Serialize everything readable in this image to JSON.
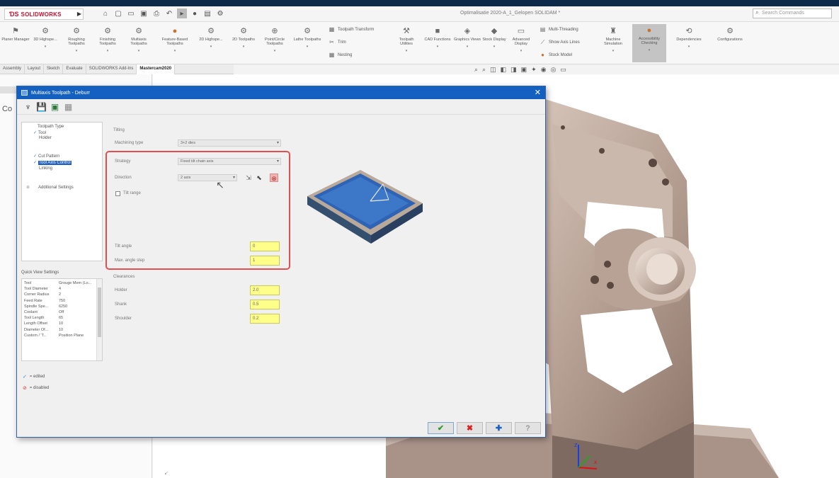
{
  "app": {
    "logo_text": "SOLIDWORKS",
    "document_title": "Optimalisatie 2020-A_1_Gelopen SOLIDAM *",
    "search_placeholder": "Search Commands"
  },
  "quick_access": [
    "home-icon",
    "new-file-icon",
    "open-icon",
    "save-icon",
    "print-icon",
    "undo-icon",
    "select-icon",
    "rebuild-icon",
    "file-properties-icon",
    "options-icon"
  ],
  "ribbon": {
    "buttons": [
      {
        "label": "Planer Manager",
        "icon": "manager-icon"
      },
      {
        "label": "3D Highspe...",
        "icon": "highspeed-icon"
      },
      {
        "label": "Roughing Toolpaths",
        "icon": "roughing-icon"
      },
      {
        "label": "Finishing Toolpaths",
        "icon": "finishing-icon"
      },
      {
        "label": "Multiaxis Toolpaths",
        "icon": "multiaxis-icon"
      },
      {
        "label": "Feature-Based Toolpaths",
        "icon": "feature-icon"
      },
      {
        "label": "2D Highspe...",
        "icon": "2d-highspeed-icon"
      },
      {
        "label": "2D Toolpaths",
        "icon": "2d-toolpath-icon"
      },
      {
        "label": "Point/Circle Toolpaths",
        "icon": "point-circle-icon"
      },
      {
        "label": "Lathe Toolpaths",
        "icon": "lathe-icon"
      },
      {
        "label": "Toolpath Utilities",
        "icon": "utilities-icon"
      },
      {
        "label": "CAD Functions",
        "icon": "cad-icon"
      },
      {
        "label": "Graphics Views",
        "icon": "graphics-icon"
      },
      {
        "label": "Stock Display",
        "icon": "stock-display-icon"
      },
      {
        "label": "Advanced Display",
        "icon": "advanced-display-icon"
      },
      {
        "label": "Machine Simulation",
        "icon": "simulation-icon"
      },
      {
        "label": "Accessibility Checking",
        "icon": "accessibility-icon"
      },
      {
        "label": "Dependencies",
        "icon": "dependencies-icon"
      },
      {
        "label": "Configurations",
        "icon": "configurations-icon"
      }
    ],
    "small_left": [
      {
        "label": "Toolpath Transform",
        "icon": "transform-icon"
      },
      {
        "label": "Trim",
        "icon": "trim-icon"
      },
      {
        "label": "Nesting",
        "icon": "nesting-icon"
      }
    ],
    "small_right": [
      {
        "label": "Multi-Threading",
        "icon": "threading-icon"
      },
      {
        "label": "Show Axis Lines",
        "icon": "axis-icon"
      },
      {
        "label": "Stock Model",
        "icon": "stock-model-icon"
      }
    ]
  },
  "tabs": [
    "Assembly",
    "Layout",
    "Sketch",
    "Evaluate",
    "SOLIDWORKS Add-Ins",
    "Mastercam2020"
  ],
  "left_panel_text": "Co",
  "dialog": {
    "title": "Multiaxis Toolpath - Deburr",
    "tree": [
      {
        "label": "Toolpath Type",
        "checked": false
      },
      {
        "label": "Tool",
        "checked": true
      },
      {
        "label": "Holder",
        "checked": false
      },
      {
        "label": "Cut Pattern",
        "checked": true
      },
      {
        "label": "Tool Axis Control",
        "checked": true,
        "selected": true
      },
      {
        "label": "Linking",
        "checked": false
      },
      {
        "label": "Additional Settings",
        "checked": false
      }
    ],
    "quick_view_label": "Quick View Settings",
    "quick_view": [
      {
        "key": "Tool",
        "value": "Grouge Mem (Lo..."
      },
      {
        "key": "Tool Diameter",
        "value": "4"
      },
      {
        "key": "Corner Radius",
        "value": "2"
      },
      {
        "key": "Feed Rate",
        "value": "750"
      },
      {
        "key": "Spindle Spe...",
        "value": "6250"
      },
      {
        "key": "Coolant",
        "value": "Off"
      },
      {
        "key": "Tool Length",
        "value": "65"
      },
      {
        "key": "Length Offset",
        "value": "10"
      },
      {
        "key": "Diameter Of...",
        "value": "10"
      },
      {
        "key": "Custom / 'T...",
        "value": "Position Plane"
      }
    ],
    "legend": [
      {
        "label": "= edited",
        "icon": "edited-check-icon"
      },
      {
        "label": "= disabled",
        "icon": "disabled-icon"
      }
    ],
    "tilting_group": "Tilting",
    "machining_type_label": "Machining type",
    "machining_type_value": "3+2 dies",
    "strategy_label": "Strategy",
    "strategy_value": "Fixed tilt chain axis",
    "direction_label": "Direction",
    "direction_value": "2 axis",
    "tilt_range_label": "Tilt range",
    "tilt_angle_label": "Tilt angle",
    "tilt_angle_value": "0",
    "max_angle_step_label": "Max. angle step",
    "max_angle_step_value": "1",
    "clearances_group": "Clearances",
    "holder_label": "Holder",
    "holder_value": "2.0",
    "shank_label": "Shank",
    "shank_value": "0.5",
    "shoulder_label": "Shoulder",
    "shoulder_value": "0.2"
  },
  "colors": {
    "accent": "#1460c0",
    "highlight": "#e05050",
    "field_yellow": "#fefe8a"
  }
}
